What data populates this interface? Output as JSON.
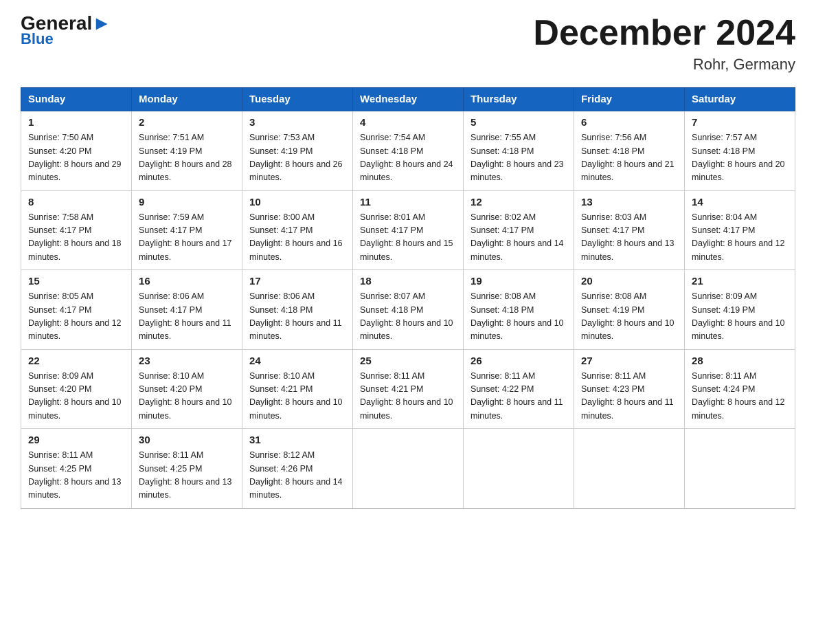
{
  "header": {
    "logo_general": "General",
    "logo_blue": "Blue",
    "month_title": "December 2024",
    "location": "Rohr, Germany"
  },
  "weekdays": [
    "Sunday",
    "Monday",
    "Tuesday",
    "Wednesday",
    "Thursday",
    "Friday",
    "Saturday"
  ],
  "weeks": [
    [
      {
        "day": "1",
        "sunrise": "7:50 AM",
        "sunset": "4:20 PM",
        "daylight": "8 hours and 29 minutes."
      },
      {
        "day": "2",
        "sunrise": "7:51 AM",
        "sunset": "4:19 PM",
        "daylight": "8 hours and 28 minutes."
      },
      {
        "day": "3",
        "sunrise": "7:53 AM",
        "sunset": "4:19 PM",
        "daylight": "8 hours and 26 minutes."
      },
      {
        "day": "4",
        "sunrise": "7:54 AM",
        "sunset": "4:18 PM",
        "daylight": "8 hours and 24 minutes."
      },
      {
        "day": "5",
        "sunrise": "7:55 AM",
        "sunset": "4:18 PM",
        "daylight": "8 hours and 23 minutes."
      },
      {
        "day": "6",
        "sunrise": "7:56 AM",
        "sunset": "4:18 PM",
        "daylight": "8 hours and 21 minutes."
      },
      {
        "day": "7",
        "sunrise": "7:57 AM",
        "sunset": "4:18 PM",
        "daylight": "8 hours and 20 minutes."
      }
    ],
    [
      {
        "day": "8",
        "sunrise": "7:58 AM",
        "sunset": "4:17 PM",
        "daylight": "8 hours and 18 minutes."
      },
      {
        "day": "9",
        "sunrise": "7:59 AM",
        "sunset": "4:17 PM",
        "daylight": "8 hours and 17 minutes."
      },
      {
        "day": "10",
        "sunrise": "8:00 AM",
        "sunset": "4:17 PM",
        "daylight": "8 hours and 16 minutes."
      },
      {
        "day": "11",
        "sunrise": "8:01 AM",
        "sunset": "4:17 PM",
        "daylight": "8 hours and 15 minutes."
      },
      {
        "day": "12",
        "sunrise": "8:02 AM",
        "sunset": "4:17 PM",
        "daylight": "8 hours and 14 minutes."
      },
      {
        "day": "13",
        "sunrise": "8:03 AM",
        "sunset": "4:17 PM",
        "daylight": "8 hours and 13 minutes."
      },
      {
        "day": "14",
        "sunrise": "8:04 AM",
        "sunset": "4:17 PM",
        "daylight": "8 hours and 12 minutes."
      }
    ],
    [
      {
        "day": "15",
        "sunrise": "8:05 AM",
        "sunset": "4:17 PM",
        "daylight": "8 hours and 12 minutes."
      },
      {
        "day": "16",
        "sunrise": "8:06 AM",
        "sunset": "4:17 PM",
        "daylight": "8 hours and 11 minutes."
      },
      {
        "day": "17",
        "sunrise": "8:06 AM",
        "sunset": "4:18 PM",
        "daylight": "8 hours and 11 minutes."
      },
      {
        "day": "18",
        "sunrise": "8:07 AM",
        "sunset": "4:18 PM",
        "daylight": "8 hours and 10 minutes."
      },
      {
        "day": "19",
        "sunrise": "8:08 AM",
        "sunset": "4:18 PM",
        "daylight": "8 hours and 10 minutes."
      },
      {
        "day": "20",
        "sunrise": "8:08 AM",
        "sunset": "4:19 PM",
        "daylight": "8 hours and 10 minutes."
      },
      {
        "day": "21",
        "sunrise": "8:09 AM",
        "sunset": "4:19 PM",
        "daylight": "8 hours and 10 minutes."
      }
    ],
    [
      {
        "day": "22",
        "sunrise": "8:09 AM",
        "sunset": "4:20 PM",
        "daylight": "8 hours and 10 minutes."
      },
      {
        "day": "23",
        "sunrise": "8:10 AM",
        "sunset": "4:20 PM",
        "daylight": "8 hours and 10 minutes."
      },
      {
        "day": "24",
        "sunrise": "8:10 AM",
        "sunset": "4:21 PM",
        "daylight": "8 hours and 10 minutes."
      },
      {
        "day": "25",
        "sunrise": "8:11 AM",
        "sunset": "4:21 PM",
        "daylight": "8 hours and 10 minutes."
      },
      {
        "day": "26",
        "sunrise": "8:11 AM",
        "sunset": "4:22 PM",
        "daylight": "8 hours and 11 minutes."
      },
      {
        "day": "27",
        "sunrise": "8:11 AM",
        "sunset": "4:23 PM",
        "daylight": "8 hours and 11 minutes."
      },
      {
        "day": "28",
        "sunrise": "8:11 AM",
        "sunset": "4:24 PM",
        "daylight": "8 hours and 12 minutes."
      }
    ],
    [
      {
        "day": "29",
        "sunrise": "8:11 AM",
        "sunset": "4:25 PM",
        "daylight": "8 hours and 13 minutes."
      },
      {
        "day": "30",
        "sunrise": "8:11 AM",
        "sunset": "4:25 PM",
        "daylight": "8 hours and 13 minutes."
      },
      {
        "day": "31",
        "sunrise": "8:12 AM",
        "sunset": "4:26 PM",
        "daylight": "8 hours and 14 minutes."
      },
      null,
      null,
      null,
      null
    ]
  ]
}
